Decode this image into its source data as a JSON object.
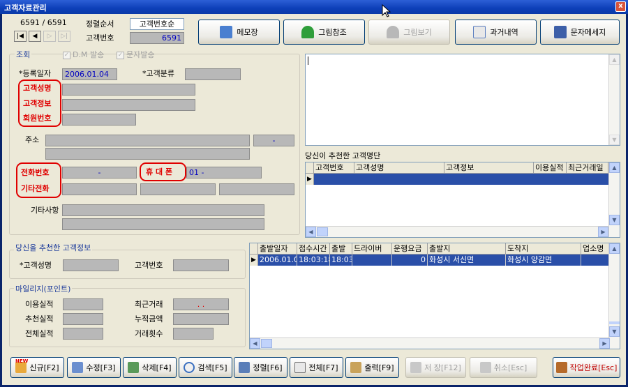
{
  "window": {
    "title": "고객자료관리",
    "close": "x"
  },
  "nav": {
    "record_counter": "6591 / 6591",
    "first": "|◀",
    "prev": "◀",
    "next": "▷",
    "last": "▷|"
  },
  "sort": {
    "label": "정렬순서",
    "value": "고객번호순",
    "custno_label": "고객번호",
    "custno_value": "6591"
  },
  "toolbar": {
    "memo": "메모장",
    "image_ref": "그림참조",
    "image_view": "그림보기",
    "history": "과거내역",
    "sms": "문자메세지"
  },
  "search": {
    "group_title": "조회",
    "dm_send": "D.M 발송",
    "sms_send": "문자발송",
    "reg_date_label": "*등록일자",
    "reg_date_value": "2006.01.04",
    "cust_type_label": "*고객분류",
    "cust_name_label": "고객성명",
    "cust_info_label": "고객정보",
    "member_no_label": "회원번호",
    "address_label": "주소",
    "address_zip": "-",
    "phone_label": "전화번호",
    "phone_value": "-",
    "mobile_label": "휴 대 폰",
    "mobile_value": "01 -",
    "other_phone_label": "기타전화",
    "misc_label": "기타사항"
  },
  "recommended_list": {
    "title": "당신이 추천한 고객명단",
    "columns": [
      "고객번호",
      "고객성명",
      "고객정보",
      "이용실적",
      "최근거래일"
    ]
  },
  "recommender": {
    "group_title": "당신을 추천한 고객정보",
    "name_label": "*고객성명",
    "no_label": "고객번호"
  },
  "mileage": {
    "group_title": "마일리지(포인트)",
    "usage_label": "이용실적",
    "recent_label": "최근거래",
    "recent_value": ".   .",
    "recommend_label": "추천실적",
    "total_amount_label": "누적금액",
    "all_label": "전체실적",
    "count_label": "거래횟수"
  },
  "trips": {
    "columns": [
      "출발일자",
      "접수시간",
      "출발",
      "드라이버",
      "운행요금",
      "출발지",
      "도착지",
      "업소명"
    ],
    "rows": [
      {
        "date": "2006.01.04",
        "recv_time": "18:03:18",
        "depart": "18:03",
        "driver": "",
        "fare": "0",
        "from": "화성시 서신면",
        "to": "화성시 양감면",
        "shop": ""
      }
    ]
  },
  "bottom": {
    "new_badge": "NEW",
    "new": "신규[F2]",
    "edit": "수정[F3]",
    "delete": "삭제[F4]",
    "find": "검색[F5]",
    "sort": "정렬[F6]",
    "all": "전체[F7]",
    "print": "출력[F9]",
    "save": "저 장[F12]",
    "cancel": "취소[Esc]",
    "done": "작업완료[Esc]"
  }
}
